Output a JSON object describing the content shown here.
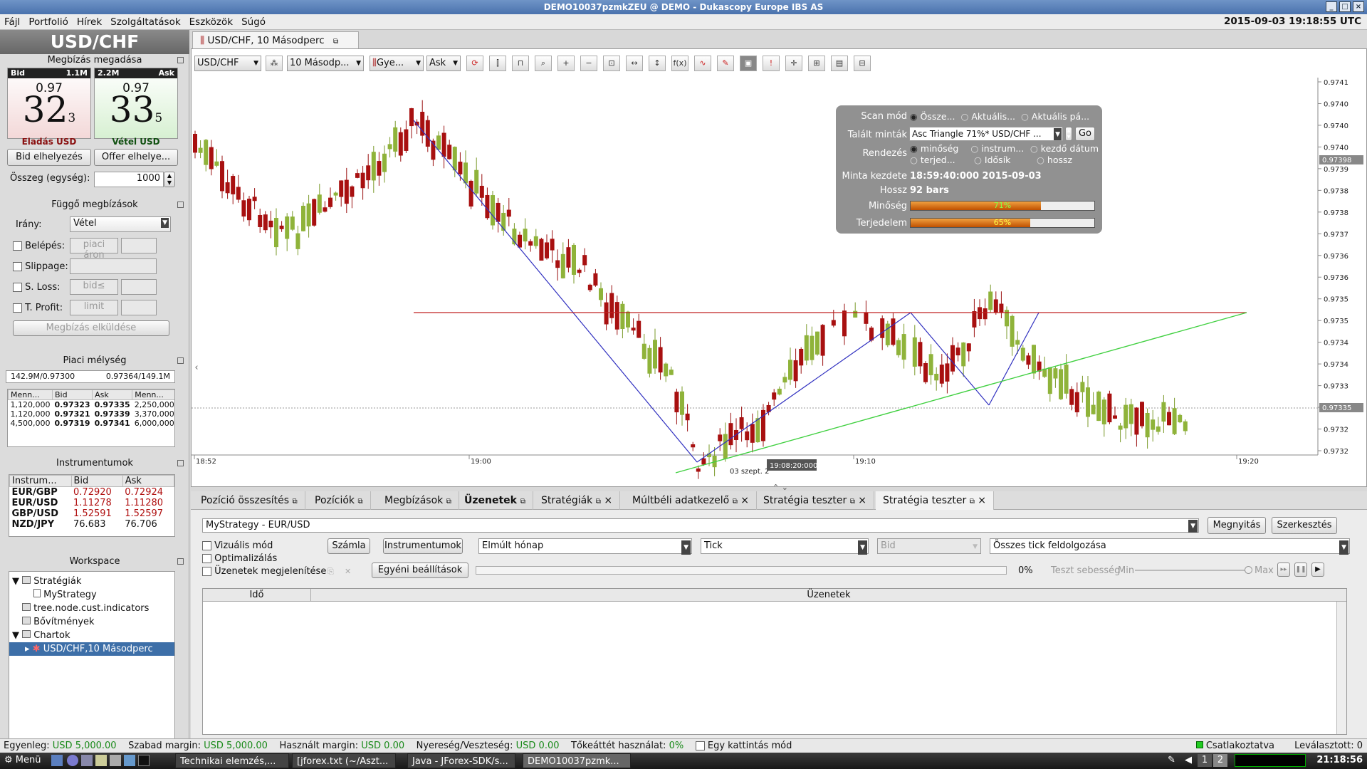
{
  "window": {
    "title": "DEMO10037pzmkZEU @ DEMO - Dukascopy Europe IBS AS",
    "clock": "2015-09-03 19:18:55 UTC"
  },
  "menu": [
    "Fájl",
    "Portfolió",
    "Hírek",
    "Szolgáltatások",
    "Eszközök",
    "Súgó"
  ],
  "left": {
    "instrument": "USD/CHF",
    "order_section": "Megbízás megadása",
    "bid": {
      "label": "Bid",
      "volume": "1.1M",
      "prefix": "0.97",
      "big": "32",
      "small": "3",
      "caption": "Eladás USD"
    },
    "ask": {
      "label": "Ask",
      "volume": "2.2M",
      "prefix": "0.97",
      "big": "33",
      "small": "5",
      "caption": "Vétel USD"
    },
    "bid_btn": "Bid elhelyezés",
    "offer_btn": "Offer elhelye...",
    "amount_label": "Összeg (egység):",
    "amount": "1000",
    "pending_section": "Függő megbízások",
    "direction_label": "Irány:",
    "direction": "Vétel",
    "entry_label": "Belépés:",
    "entry_ph": "piaci áron",
    "slippage_label": "Slippage:",
    "sl_label": "S. Loss:",
    "sl_ph": "bid≤",
    "tp_label": "T. Profit:",
    "tp_ph": "limit",
    "send_btn": "Megbízás elküldése",
    "depth_section": "Piaci mélység",
    "depth_summary_left": "142.9M/0.97300",
    "depth_summary_right": "0.97364/149.1M",
    "depth_headers": [
      "Menn...",
      "Bid",
      "Ask",
      "Menn..."
    ],
    "depth_rows": [
      [
        "1,120,000",
        "0.97323",
        "0.97335",
        "2,250,000"
      ],
      [
        "1,120,000",
        "0.97321",
        "0.97339",
        "3,370,000"
      ],
      [
        "4,500,000",
        "0.97319",
        "0.97341",
        "6,000,000"
      ]
    ],
    "instr_section": "Instrumentumok",
    "instr_headers": [
      "Instrum...",
      "Bid",
      "Ask"
    ],
    "instr_rows": [
      [
        "EUR/GBP",
        "0.72920",
        "0.72924"
      ],
      [
        "EUR/USD",
        "1.11278",
        "1.11280"
      ],
      [
        "GBP/USD",
        "1.52591",
        "1.52597"
      ],
      [
        "NZD/JPY",
        "76.683",
        "76.706"
      ]
    ],
    "ws_section": "Workspace",
    "ws_tree": [
      "Stratégiák",
      "MyStrategy",
      "tree.node.cust.indicators",
      "Bővítmények",
      "Chartok",
      "USD/CHF,10 Másodperc"
    ]
  },
  "chart": {
    "tab": "USD/CHF, 10 Másodperc",
    "toolbar": {
      "instrument": "USD/CHF",
      "period": "10 Másodp...",
      "type": "Gye...",
      "side": "Ask"
    },
    "price_labels": [
      "0.9741",
      "0.9740",
      "0.9740",
      "0.9740",
      "0.9739",
      "0.9738",
      "0.9738",
      "0.9737",
      "0.9736",
      "0.9736",
      "0.9735",
      "0.9735",
      "0.9734",
      "0.9734",
      "0.9733",
      "0.9733",
      "0.9732",
      "0.9732"
    ],
    "price_marker_top": "0.97398",
    "price_marker_mid": "0.97335",
    "time_labels": [
      "18:52",
      "19:00",
      "19:10",
      "19:20"
    ],
    "date_label": "03 szept. 2",
    "cursor_time": "19:08:20:000"
  },
  "scan": {
    "mode_label": "Scan mód",
    "mode_opts": [
      "Össze...",
      "Aktuális...",
      "Aktuális pá..."
    ],
    "found_label": "Talált minták",
    "found_value": "Asc Triangle 71%* USD/CHF ...",
    "go": "Go",
    "sort_label": "Rendezés",
    "sort_opts": [
      "minőség",
      "instrum...",
      "kezdő dátum",
      "terjed...",
      "Idősík",
      "hossz"
    ],
    "start_label": "Minta kezdete",
    "start_value": "18:59:40:000 2015-09-03",
    "len_label": "Hossz",
    "len_value": "92 bars",
    "quality_label": "Minőség",
    "quality_text": "71%",
    "quality": 0.71,
    "extent_label": "Terjedelem",
    "extent_text": "65%",
    "extent": 0.65
  },
  "bottom": {
    "tabs": [
      "Pozíció összesítés",
      "Pozíciók",
      "Megbízások",
      "Üzenetek",
      "Stratégiák",
      "Múltbéli adatkezelő",
      "Stratégia teszter",
      "Stratégia teszter"
    ],
    "strategy": "MyStrategy  -  EUR/USD",
    "open_btn": "Megnyitás",
    "edit_btn": "Szerkesztés",
    "visual": "Vizuális mód",
    "optim": "Optimalizálás",
    "msgs": "Üzenetek megjelenítése",
    "account_btn": "Számla",
    "instr_btn": "Instrumentumok",
    "period": "Elmúlt hónap",
    "tick": "Tick",
    "bid": "Bid",
    "all_ticks": "Összes tick feldolgozása",
    "custom_btn": "Egyéni beállítások",
    "progress": "0%",
    "speed": "Teszt sebesség",
    "min": "Min",
    "max": "Max",
    "col_time": "Idő",
    "col_msgs": "Üzenetek"
  },
  "status": {
    "balance_label": "Egyenleg:",
    "balance": "USD 5,000.00",
    "free_label": "Szabad margin:",
    "free": "USD 5,000.00",
    "used_label": "Használt margin:",
    "used": "USD 0.00",
    "pl_label": "Nyereség/Veszteség:",
    "pl": "USD 0.00",
    "lev_label": "Tőkeáttét használat:",
    "lev": "0%",
    "oneclick": "Egy kattintás mód",
    "connected": "Csatlakoztatva",
    "orders": "Leválasztott: 0"
  },
  "taskbar": {
    "menu": "Menü",
    "tasks": [
      "Technikai elemzés,...",
      "[jforex.txt (~/Aszt...",
      "Java - JForex-SDK/s...",
      "DEMO10037pzmk..."
    ],
    "ws1": "1",
    "ws2": "2",
    "time": "21:18:56"
  },
  "chart_data": {
    "type": "candlestick",
    "xlabel": "",
    "ylabel": "",
    "ylim": [
      0.97315,
      0.97415
    ]
  }
}
